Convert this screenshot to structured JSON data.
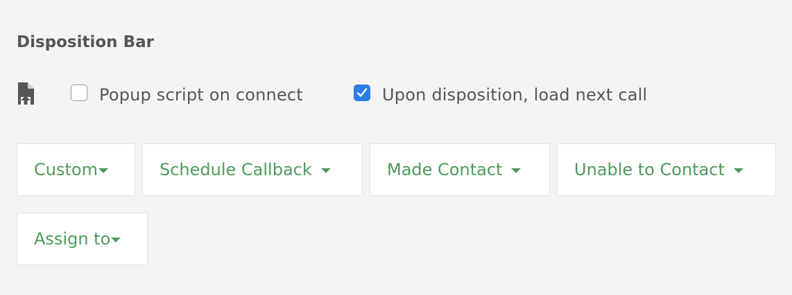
{
  "panel": {
    "title": "Disposition Bar"
  },
  "options": {
    "script_icon": "document-upload-icon",
    "popup_script": {
      "label": "Popup script on connect",
      "checked": false
    },
    "load_next_call": {
      "label": "Upon disposition, load next call",
      "checked": true
    }
  },
  "dispositions": [
    {
      "label": "Custom"
    },
    {
      "label": "Schedule Callback"
    },
    {
      "label": "Made Contact"
    },
    {
      "label": "Unable to Contact"
    },
    {
      "label": "Assign to"
    }
  ],
  "colors": {
    "background": "#f4f4f4",
    "text": "#555555",
    "button_text": "#4f9a5c",
    "checkbox_checked": "#2c7ee6"
  }
}
